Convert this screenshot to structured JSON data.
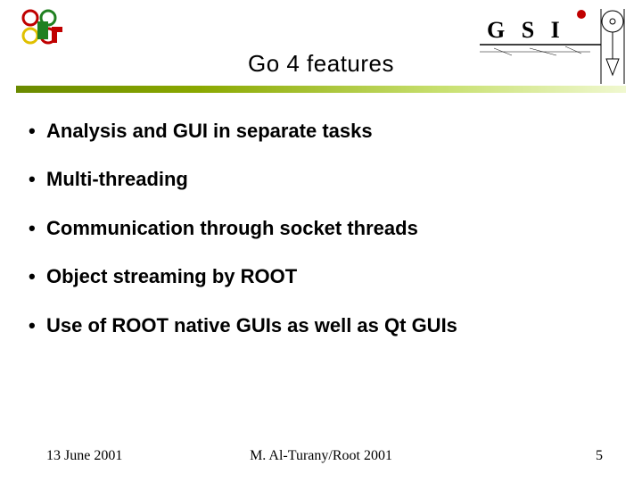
{
  "header": {
    "title": "Go 4 features"
  },
  "bullets": [
    "Analysis and GUI in separate tasks",
    "Multi-threading",
    "Communication through socket threads",
    "Object streaming by ROOT",
    "Use of ROOT native GUIs as well as Qt GUIs"
  ],
  "footer": {
    "date": "13 June 2001",
    "author": "M. Al-Turany/Root 2001",
    "page": "5"
  }
}
